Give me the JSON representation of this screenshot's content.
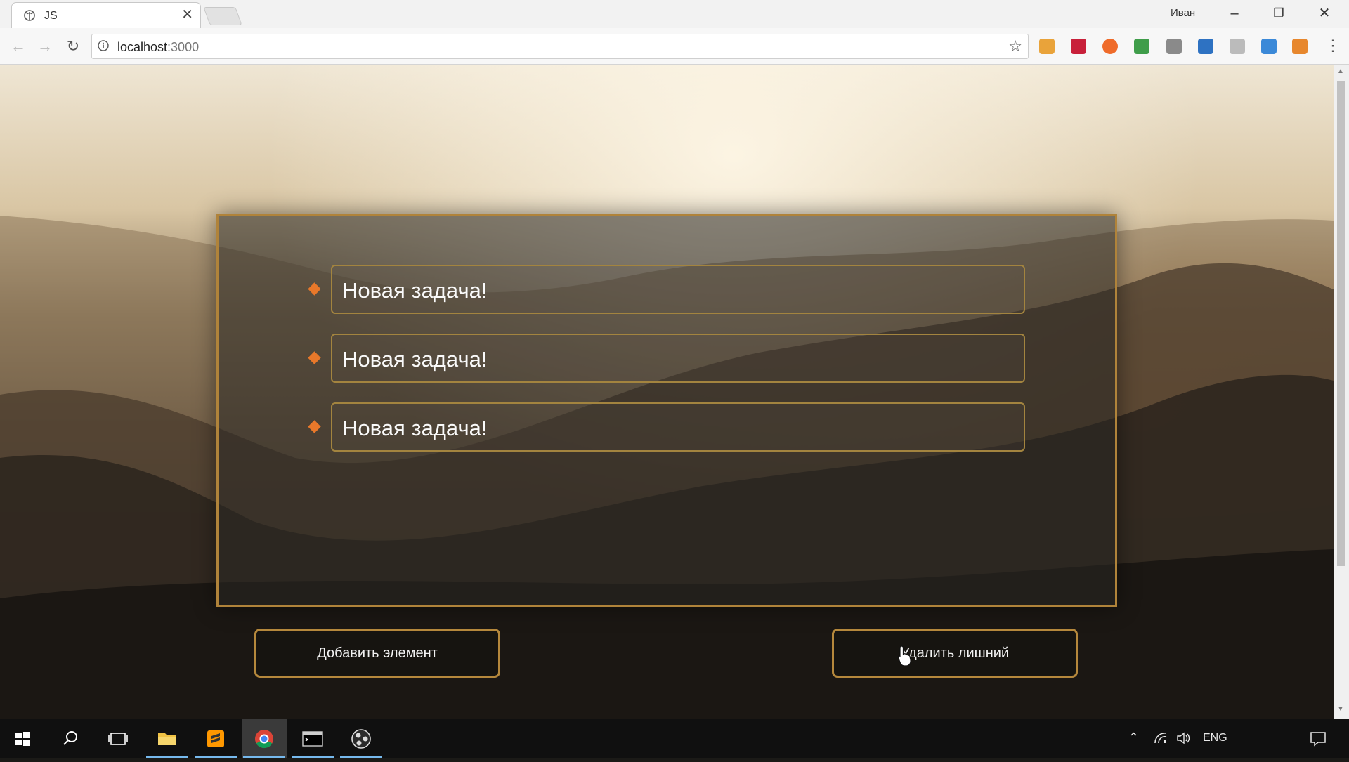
{
  "browser": {
    "tab_title": "JS",
    "profile_name": "Иван",
    "url_host": "localhost",
    "url_port": ":3000"
  },
  "tasks": [
    {
      "text": "Новая задача!"
    },
    {
      "text": "Новая задача!"
    },
    {
      "text": "Новая задача!"
    }
  ],
  "buttons": {
    "add": "Добавить элемент",
    "remove": "Удалить лишний"
  },
  "taskbar": {
    "language": "ENG"
  },
  "colors": {
    "accent_border": "#b0833a",
    "bullet": "#e8782a"
  }
}
